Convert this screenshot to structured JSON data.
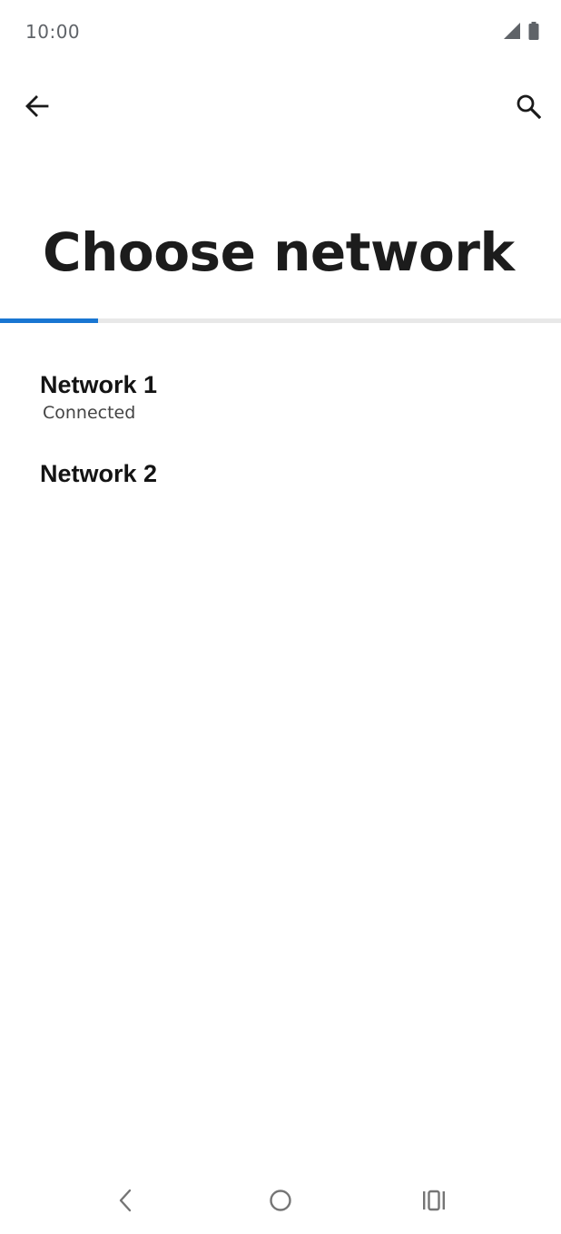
{
  "status_bar": {
    "time": "10:00"
  },
  "header": {
    "title": "Choose network"
  },
  "progress": {
    "fraction": 0.175,
    "color": "#1976d2"
  },
  "networks": [
    {
      "name": "Network 1",
      "status": "Connected"
    },
    {
      "name": "Network 2"
    }
  ],
  "icons": {
    "back": "arrow-left-icon",
    "search": "search-icon",
    "signal": "signal-icon",
    "battery": "battery-icon",
    "nav_back": "nav-back-icon",
    "nav_home": "nav-home-icon",
    "nav_recents": "nav-recents-icon"
  }
}
